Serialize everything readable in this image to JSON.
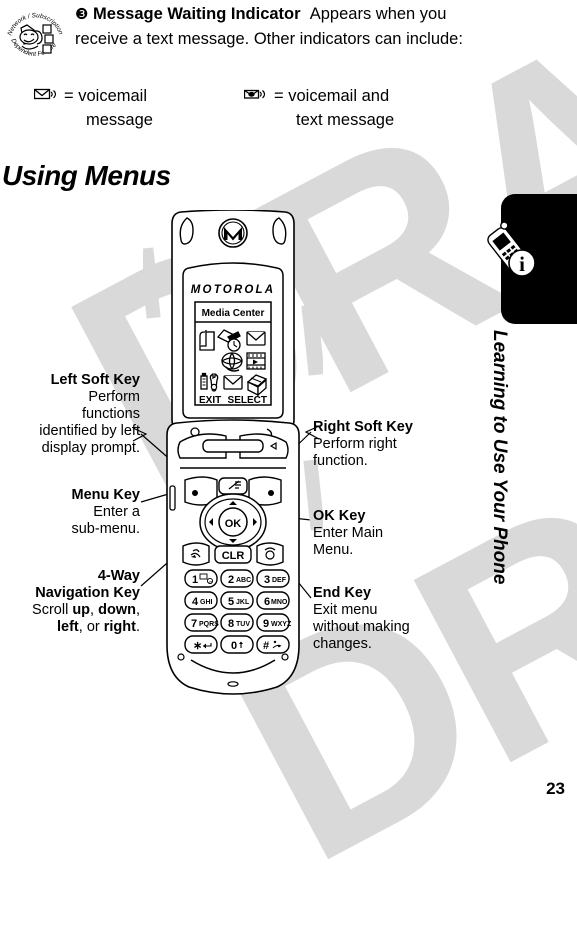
{
  "document": {
    "page_number": "23",
    "watermark": "DRAFT",
    "side_tab_label": "Learning to Use Your Phone"
  },
  "note": {
    "marker": "❸",
    "title": "Message Waiting Indicator",
    "body": "Appears when you receive a text message. Other indicators can include:",
    "stamp_line1": "Network / Subscription",
    "stamp_line2": "Dependent Feature",
    "indicators": [
      {
        "icon": "envelope-voicemail-icon",
        "equals": "=",
        "label_line1": "voicemail",
        "label_line2": "message"
      },
      {
        "icon": "envelope-voicemail-text-icon",
        "equals": "=",
        "label_line1": "voicemail and",
        "label_line2": "text message"
      }
    ]
  },
  "section": {
    "heading": "Using Menus"
  },
  "phone": {
    "brand": "MOTOROLA",
    "screen": {
      "title": "Media Center",
      "icons": [
        "files-icon",
        "tools-clock-icon",
        "message-envelope-icon",
        "",
        "web-globe-icon",
        "multimedia-icon",
        "settings-icon",
        "message-envelope-icon",
        "open-box-icon"
      ],
      "softkey_left": "EXIT",
      "softkey_right": "SELECT"
    },
    "keys": {
      "clear": "CLR",
      "nav_up": "▲",
      "nav_down": "▼",
      "nav_left": "◀",
      "nav_right": "▶",
      "ok": "OK",
      "keypad": [
        {
          "digit": "1",
          "letters": ""
        },
        {
          "digit": "2",
          "letters": "ABC"
        },
        {
          "digit": "3",
          "letters": "DEF"
        },
        {
          "digit": "4",
          "letters": "GHI"
        },
        {
          "digit": "5",
          "letters": "JKL"
        },
        {
          "digit": "6",
          "letters": "MNO"
        },
        {
          "digit": "7",
          "letters": "PQRS"
        },
        {
          "digit": "8",
          "letters": "TUV"
        },
        {
          "digit": "9",
          "letters": "WXYZ"
        },
        {
          "digit": "∗",
          "letters": ""
        },
        {
          "digit": "0",
          "letters": ""
        },
        {
          "digit": "#",
          "letters": ""
        }
      ]
    }
  },
  "callouts": {
    "left_soft_key": {
      "title": "Left Soft Key",
      "body_l1": "Perform",
      "body_l2": "functions",
      "body_l3": "identified by left",
      "body_l4": "display prompt."
    },
    "menu_key": {
      "title": "Menu Key",
      "body_l1": "Enter a",
      "body_l2": "sub-menu."
    },
    "nav_key": {
      "title_l1": "4-Way",
      "title_l2": "Navigation Key",
      "body_pre": "Scroll ",
      "b1": "up",
      "sep1": ", ",
      "b2": "down",
      "sep2": ",",
      "b3": "left",
      "sep3": ", or ",
      "b4": "right",
      "sep4": "."
    },
    "right_soft_key": {
      "title": "Right Soft Key",
      "body_l1": "Perform right",
      "body_l2": "function."
    },
    "ok_key": {
      "title": "OK Key",
      "body_l1": "Enter Main",
      "body_l2": "Menu."
    },
    "end_key": {
      "title": "End Key",
      "body_l1": "Exit menu",
      "body_l2": "without making",
      "body_l3": "changes."
    }
  },
  "colors": {
    "ink": "#000000",
    "watermark": "#d9d9d9",
    "paper": "#ffffff"
  }
}
